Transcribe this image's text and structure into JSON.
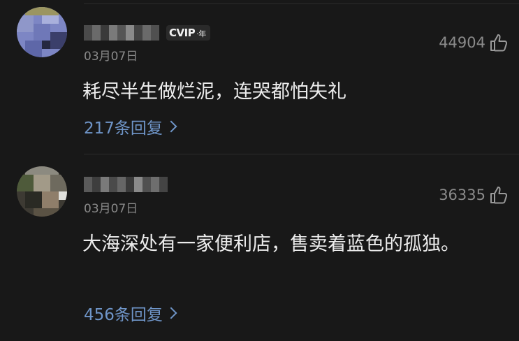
{
  "comments": [
    {
      "username_hidden": true,
      "vip_badge": {
        "text": "VIP",
        "suffix": "·年",
        "prefix_glyph": "C"
      },
      "date": "03月07日",
      "like_count": "44904",
      "content": "耗尽半生做烂泥，连哭都怕失礼",
      "replies": "217条回复"
    },
    {
      "username_hidden": true,
      "date": "03月07日",
      "like_count": "36335",
      "content": "大海深处有一家便利店，售卖着蓝色的孤独。",
      "replies": "456条回复"
    }
  ],
  "colors": {
    "background": "#181818",
    "text_primary": "#ececec",
    "text_secondary": "#8a8a8a",
    "link": "#6f95c8"
  },
  "icons": [
    "thumb-up-icon",
    "chevron-right-icon"
  ]
}
